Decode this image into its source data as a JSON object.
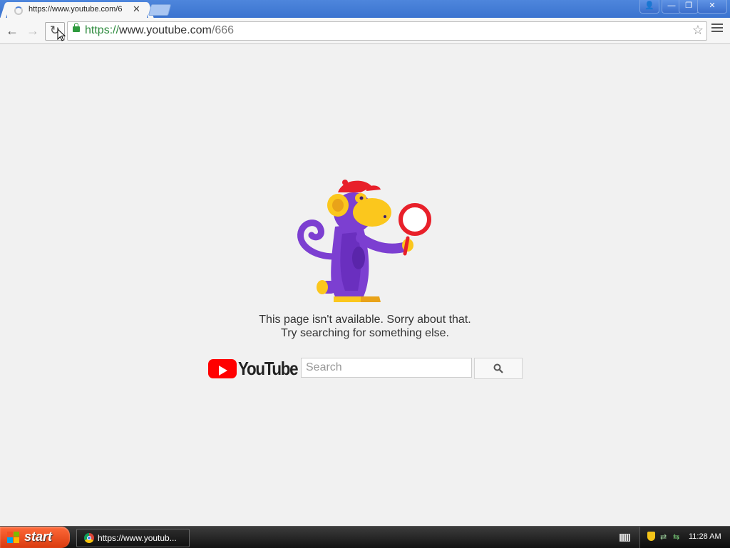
{
  "browser": {
    "tab": {
      "title": "https://www.youtube.com/6",
      "close": "✕"
    },
    "window_buttons": {
      "profile": "👤",
      "minimize": "—",
      "maximize": "❐",
      "close": "✕"
    },
    "nav": {
      "back": "←",
      "forward": "→",
      "reload": "↻"
    },
    "omnibox": {
      "scheme": "https://",
      "host": "www.youtube.com",
      "path": "/666"
    },
    "star": "☆"
  },
  "page": {
    "error_line1": "This page isn't available. Sorry about that.",
    "error_line2": "Try searching for something else.",
    "logo_text": "YouTube",
    "search": {
      "placeholder": "Search"
    }
  },
  "taskbar": {
    "start_label": "start",
    "task_item_label": "https://www.youtub...",
    "clock": "11:28 AM"
  },
  "colors": {
    "youtube_red": "#ff0000",
    "monkey_purple": "#7c3fd1",
    "monkey_yellow": "#fbc71d",
    "cap_red": "#e8202a"
  }
}
